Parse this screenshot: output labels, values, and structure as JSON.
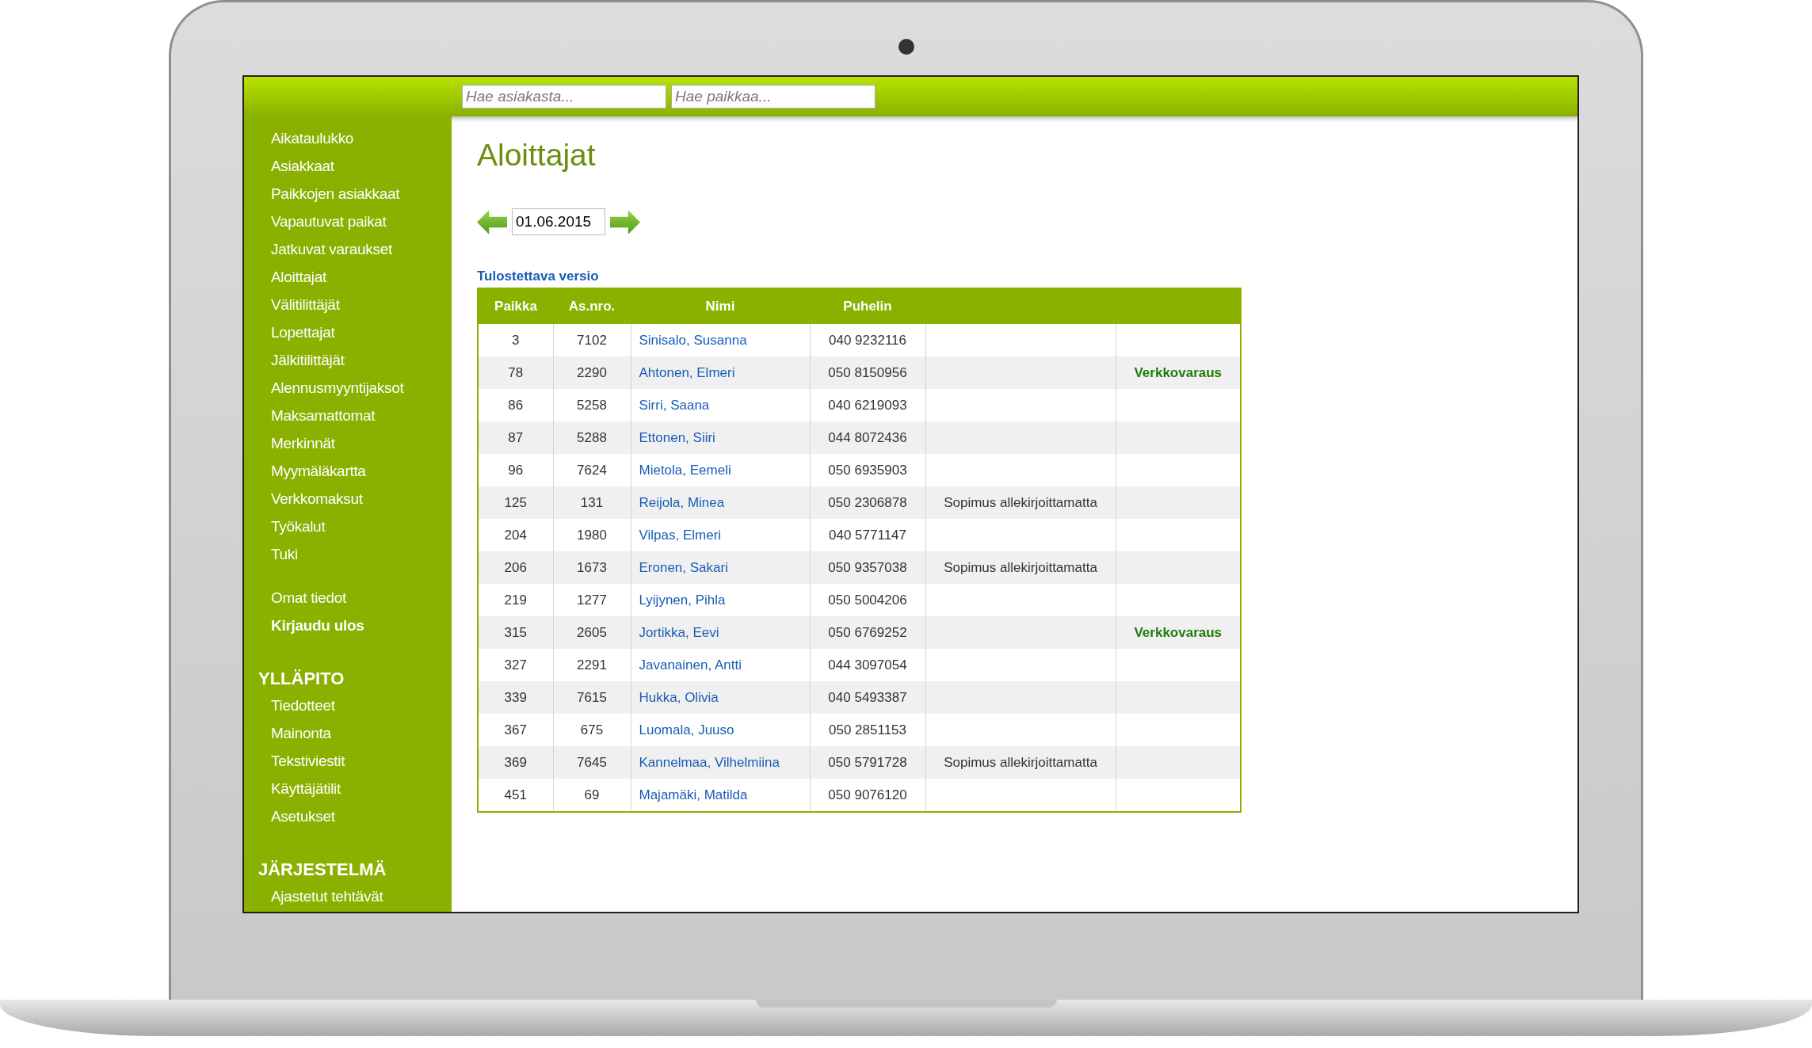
{
  "topbar": {
    "search_customer": {
      "placeholder": "Hae asiakasta..."
    },
    "search_place": {
      "placeholder": "Hae paikkaa..."
    }
  },
  "sidebar": {
    "sections": [
      {
        "items": [
          {
            "label": "Aikataulukko"
          },
          {
            "label": "Asiakkaat"
          },
          {
            "label": "Paikkojen asiakkaat"
          },
          {
            "label": "Vapautuvat paikat"
          },
          {
            "label": "Jatkuvat varaukset"
          },
          {
            "label": "Aloittajat"
          },
          {
            "label": "Välitilittäjät"
          },
          {
            "label": "Lopettajat"
          },
          {
            "label": "Jälkitilittäjät"
          },
          {
            "label": "Alennusmyyntijaksot"
          },
          {
            "label": "Maksamattomat"
          },
          {
            "label": "Merkinnät"
          },
          {
            "label": "Myymäläkartta"
          },
          {
            "label": "Verkkomaksut"
          },
          {
            "label": "Työkalut"
          },
          {
            "label": "Tuki"
          }
        ]
      },
      {
        "items": [
          {
            "label": "Omat tiedot",
            "kind": "link"
          },
          {
            "label": "Kirjaudu ulos",
            "kind": "logout"
          }
        ]
      },
      {
        "heading": "YLLÄPITO",
        "items": [
          {
            "label": "Tiedotteet"
          },
          {
            "label": "Mainonta"
          },
          {
            "label": "Tekstiviestit"
          },
          {
            "label": "Käyttäjätilit"
          },
          {
            "label": "Asetukset"
          }
        ]
      },
      {
        "heading": "JÄRJESTELMÄ",
        "items": [
          {
            "label": "Ajastetut tehtävät"
          }
        ]
      }
    ]
  },
  "page": {
    "title": "Aloittajat",
    "date": "01.06.2015",
    "print_link": "Tulostettava versio"
  },
  "table": {
    "columns": [
      "Paikka",
      "As.nro.",
      "Nimi",
      "Puhelin"
    ],
    "rows": [
      {
        "place": "3",
        "number": "7102",
        "name": "Sinisalo, Susanna",
        "phone": "040 9232116"
      },
      {
        "place": "78",
        "number": "2290",
        "name": "Ahtonen, Elmeri",
        "phone": "050 8150956",
        "status": "Verkkovaraus"
      },
      {
        "place": "86",
        "number": "5258",
        "name": "Sirri, Saana",
        "phone": "040 6219093"
      },
      {
        "place": "87",
        "number": "5288",
        "name": "Ettonen, Siiri",
        "phone": "044 8072436"
      },
      {
        "place": "96",
        "number": "7624",
        "name": "Mietola, Eemeli",
        "phone": "050 6935903"
      },
      {
        "place": "125",
        "number": "131",
        "name": "Reijola, Minea",
        "phone": "050 2306878",
        "note": "Sopimus allekirjoittamatta"
      },
      {
        "place": "204",
        "number": "1980",
        "name": "Vilpas, Elmeri",
        "phone": "040 5771147"
      },
      {
        "place": "206",
        "number": "1673",
        "name": "Eronen, Sakari",
        "phone": "050 9357038",
        "note": "Sopimus allekirjoittamatta"
      },
      {
        "place": "219",
        "number": "1277",
        "name": "Lyijynen, Pihla",
        "phone": "050 5004206"
      },
      {
        "place": "315",
        "number": "2605",
        "name": "Jortikka, Eevi",
        "phone": "050 6769252",
        "status": "Verkkovaraus"
      },
      {
        "place": "327",
        "number": "2291",
        "name": "Javanainen, Antti",
        "phone": "044 3097054"
      },
      {
        "place": "339",
        "number": "7615",
        "name": "Hukka, Olivia",
        "phone": "040 5493387"
      },
      {
        "place": "367",
        "number": "675",
        "name": "Luomala, Juuso",
        "phone": "050 2851153"
      },
      {
        "place": "369",
        "number": "7645",
        "name": "Kannelmaa, Vilhelmiina",
        "phone": "050 5791728",
        "note": "Sopimus allekirjoittamatta"
      },
      {
        "place": "451",
        "number": "69",
        "name": "Majamäki, Matilda",
        "phone": "050 9076120"
      }
    ]
  }
}
